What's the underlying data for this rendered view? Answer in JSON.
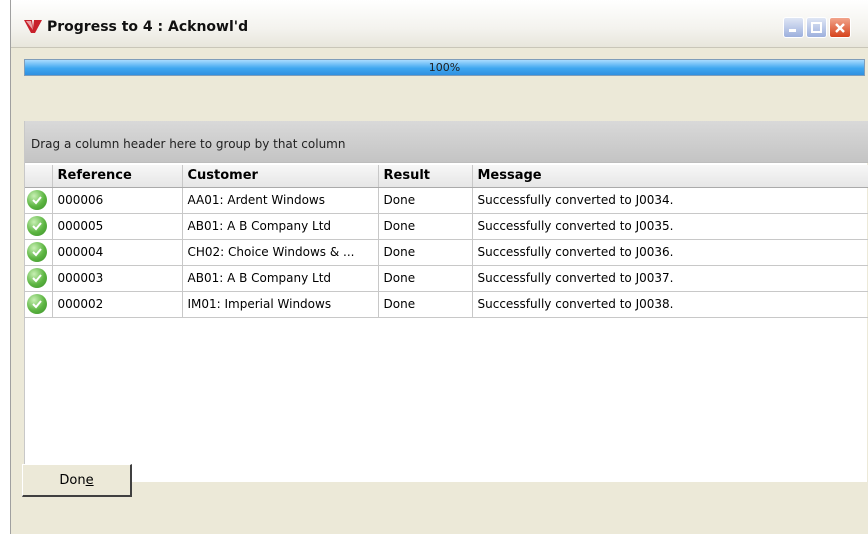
{
  "window": {
    "title": "Progress to 4 : Acknowl'd"
  },
  "progress": {
    "text": "100%",
    "value": 1.0
  },
  "grid": {
    "group_hint": "Drag a column header here to group by that column",
    "columns": [
      "Reference",
      "Customer",
      "Result",
      "Message"
    ],
    "rows": [
      {
        "reference": "000006",
        "customer": "AA01: Ardent Windows",
        "result": "Done",
        "message": "Successfully converted to J0034."
      },
      {
        "reference": "000005",
        "customer": "AB01: A B Company Ltd",
        "result": "Done",
        "message": "Successfully converted to J0035."
      },
      {
        "reference": "000004",
        "customer": "CH02: Choice Windows & ...",
        "result": "Done",
        "message": "Successfully converted to J0036."
      },
      {
        "reference": "000003",
        "customer": "AB01: A B Company Ltd",
        "result": "Done",
        "message": "Successfully converted to J0037."
      },
      {
        "reference": "000002",
        "customer": "IM01: Imperial Windows",
        "result": "Done",
        "message": "Successfully converted to J0038."
      }
    ]
  },
  "buttons": {
    "done_prefix": "Don",
    "done_mnemonic": "e"
  },
  "icons": {
    "app": "app-logo-icon",
    "row_status": "check-circle-icon",
    "minimize": "minimize-icon",
    "maximize": "maximize-icon",
    "close": "close-icon"
  },
  "colors": {
    "progress": "#3fa7f0",
    "close_button": "#d6431c",
    "ok_icon": "#5cb541"
  }
}
